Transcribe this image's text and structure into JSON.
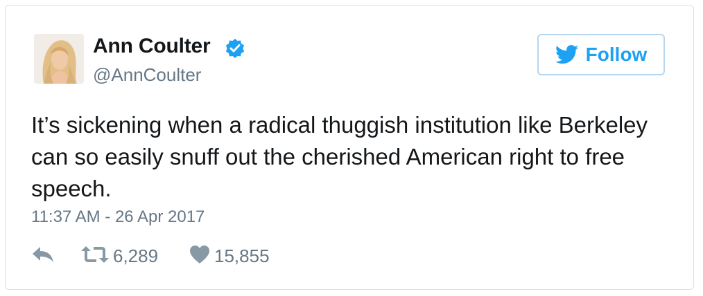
{
  "tweet": {
    "author_name": "Ann Coulter",
    "handle": "@AnnCoulter",
    "verified": true,
    "follow_label": "Follow",
    "text": "It’s sickening when a radical thuggish institution like Berkeley can so easily snuff out the cherished American right to free speech.",
    "timestamp": "11:37 AM - 26 Apr 2017",
    "retweet_count": "6,289",
    "like_count": "15,855"
  },
  "icons": {
    "verified": "verified-badge-icon",
    "follow": "twitter-bird-icon",
    "reply": "reply-icon",
    "retweet": "retweet-icon",
    "like": "heart-icon"
  },
  "colors": {
    "accent": "#1da1f2",
    "muted": "#657786",
    "text": "#14171a",
    "border": "#dcdfe3"
  }
}
